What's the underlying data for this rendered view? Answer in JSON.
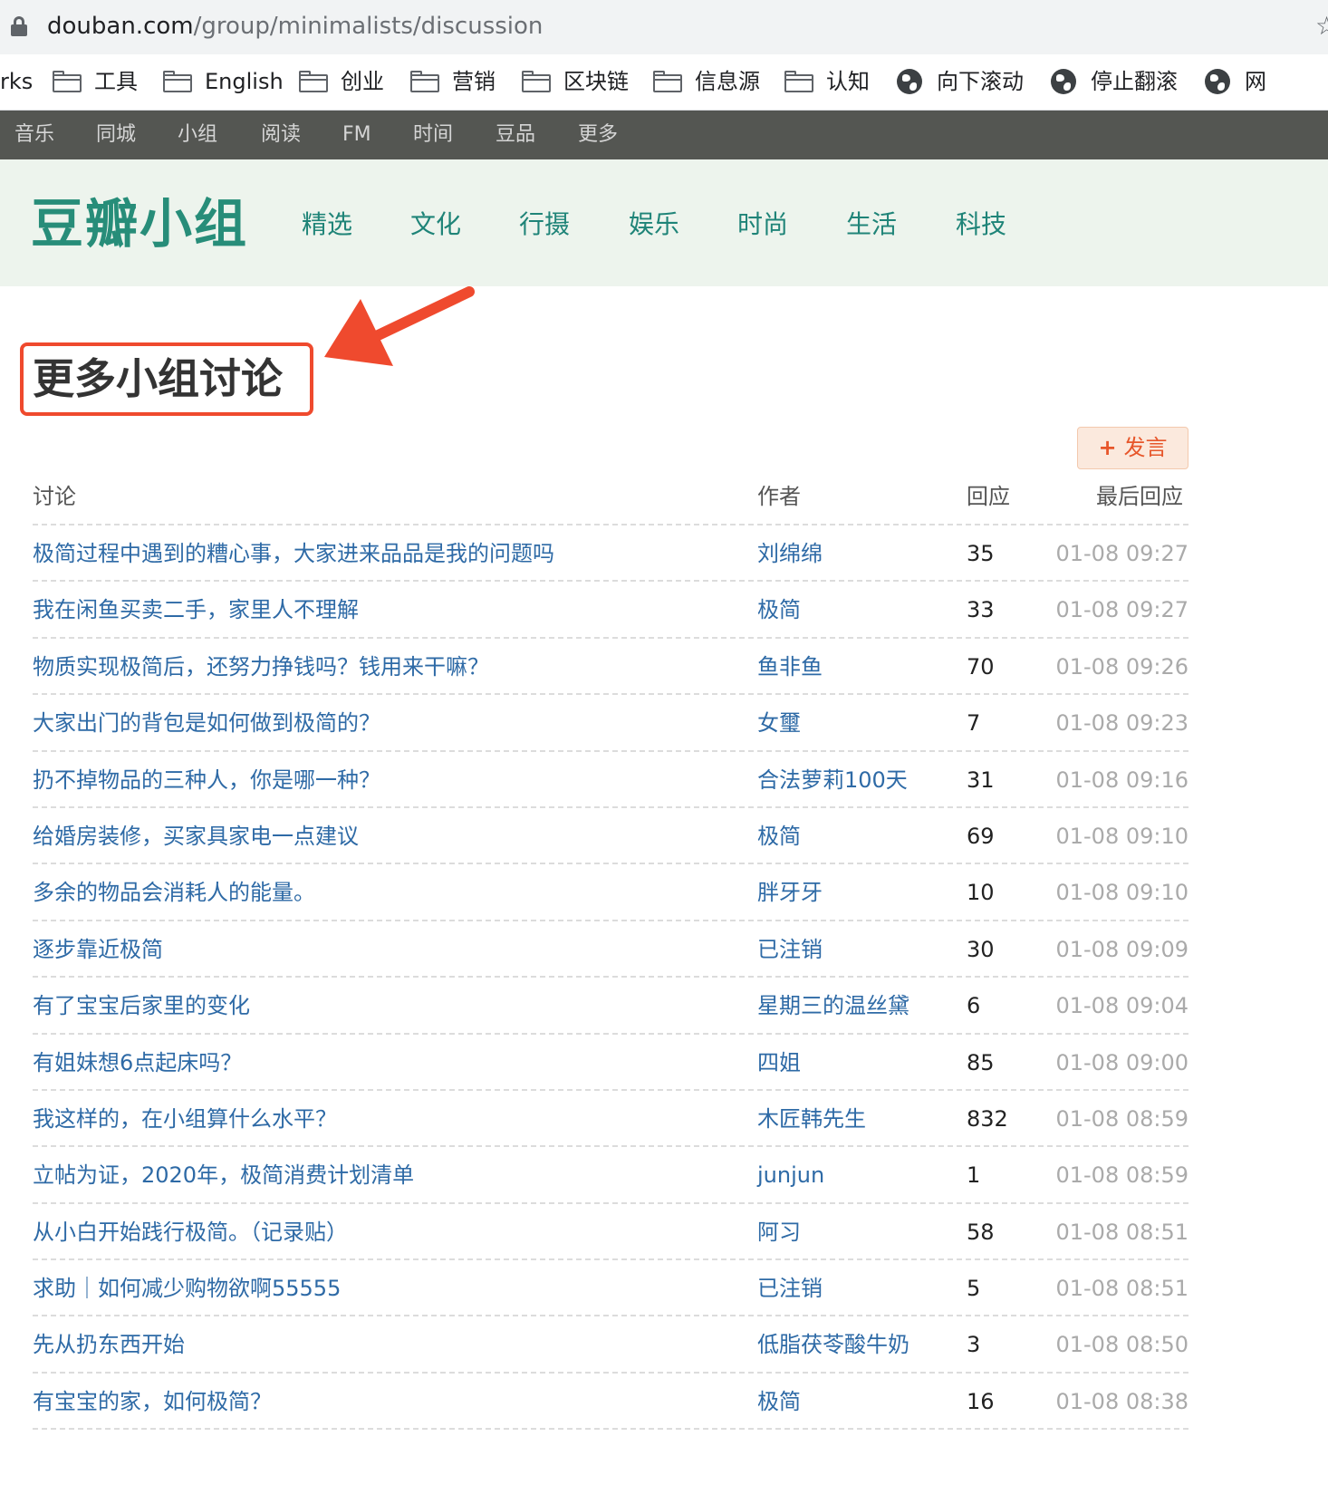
{
  "browser": {
    "url_host": "douban.com",
    "url_path": "/group/minimalists/discussion",
    "star_icon": "star-icon"
  },
  "bookmarks": [
    {
      "label": "rks",
      "icon": ""
    },
    {
      "label": "工具",
      "icon": "folder-icon"
    },
    {
      "label": "English",
      "icon": "folder-icon"
    },
    {
      "label": "创业",
      "icon": "folder-icon"
    },
    {
      "label": "营销",
      "icon": "folder-icon"
    },
    {
      "label": "区块链",
      "icon": "folder-icon"
    },
    {
      "label": "信息源",
      "icon": "folder-icon"
    },
    {
      "label": "认知",
      "icon": "folder-icon"
    },
    {
      "label": "向下滚动",
      "icon": "globe-icon"
    },
    {
      "label": "停止翻滚",
      "icon": "globe-icon"
    },
    {
      "label": "网",
      "icon": "globe-icon"
    }
  ],
  "global_nav": [
    "音乐",
    "同城",
    "小组",
    "阅读",
    "FM",
    "时间",
    "豆品",
    "更多"
  ],
  "group_header": {
    "logo": "豆瓣小组",
    "categories": [
      "精选",
      "文化",
      "行摄",
      "娱乐",
      "时尚",
      "生活",
      "科技"
    ]
  },
  "page": {
    "title": "更多小组讨论",
    "post_button": "发言",
    "post_button_icon": "+"
  },
  "table": {
    "headers": {
      "topic": "讨论",
      "author": "作者",
      "replies": "回应",
      "last_reply": "最后回应"
    },
    "rows": [
      {
        "topic": "极简过程中遇到的糟心事，大家进来品品是我的问题吗",
        "author": "刘绵绵",
        "replies": "35",
        "time": "01-08 09:27"
      },
      {
        "topic": "我在闲鱼买卖二手，家里人不理解",
        "author": "极简",
        "replies": "33",
        "time": "01-08 09:27"
      },
      {
        "topic": "物质实现极简后，还努力挣钱吗？钱用来干嘛？",
        "author": "鱼非鱼",
        "replies": "70",
        "time": "01-08 09:26"
      },
      {
        "topic": "大家出门的背包是如何做到极简的？",
        "author": "女璽",
        "replies": "7",
        "time": "01-08 09:23"
      },
      {
        "topic": "扔不掉物品的三种人，你是哪一种？",
        "author": "合法萝莉100天",
        "replies": "31",
        "time": "01-08 09:16"
      },
      {
        "topic": "给婚房装修，买家具家电一点建议",
        "author": "极简",
        "replies": "69",
        "time": "01-08 09:10"
      },
      {
        "topic": "多余的物品会消耗人的能量。",
        "author": "胖牙牙",
        "replies": "10",
        "time": "01-08 09:10"
      },
      {
        "topic": "逐步靠近极简",
        "author": "已注销",
        "replies": "30",
        "time": "01-08 09:09"
      },
      {
        "topic": "有了宝宝后家里的变化",
        "author": "星期三的温丝黛",
        "replies": "6",
        "time": "01-08 09:04"
      },
      {
        "topic": "有姐妹想6点起床吗？",
        "author": "四姐",
        "replies": "85",
        "time": "01-08 09:00"
      },
      {
        "topic": "我这样的，在小组算什么水平？",
        "author": "木匠韩先生",
        "replies": "832",
        "time": "01-08 08:59"
      },
      {
        "topic": "立帖为证，2020年，极简消费计划清单",
        "author": "junjun",
        "replies": "1",
        "time": "01-08 08:59"
      },
      {
        "topic": "从小白开始践行极简。（记录贴）",
        "author": "阿习",
        "replies": "58",
        "time": "01-08 08:51"
      },
      {
        "topic": "求助｜如何减少购物欲啊55555",
        "author": "已注销",
        "replies": "5",
        "time": "01-08 08:51"
      },
      {
        "topic": "先从扔东西开始",
        "author": "低脂茯苓酸牛奶",
        "replies": "3",
        "time": "01-08 08:50"
      },
      {
        "topic": "有宝宝的家，如何极简？",
        "author": "极简",
        "replies": "16",
        "time": "01-08 08:38"
      }
    ]
  },
  "colors": {
    "accent_arrow": "#ef4a2e",
    "link": "#2e6aa6",
    "logo": "#278d79",
    "nav_bg": "#545652"
  }
}
